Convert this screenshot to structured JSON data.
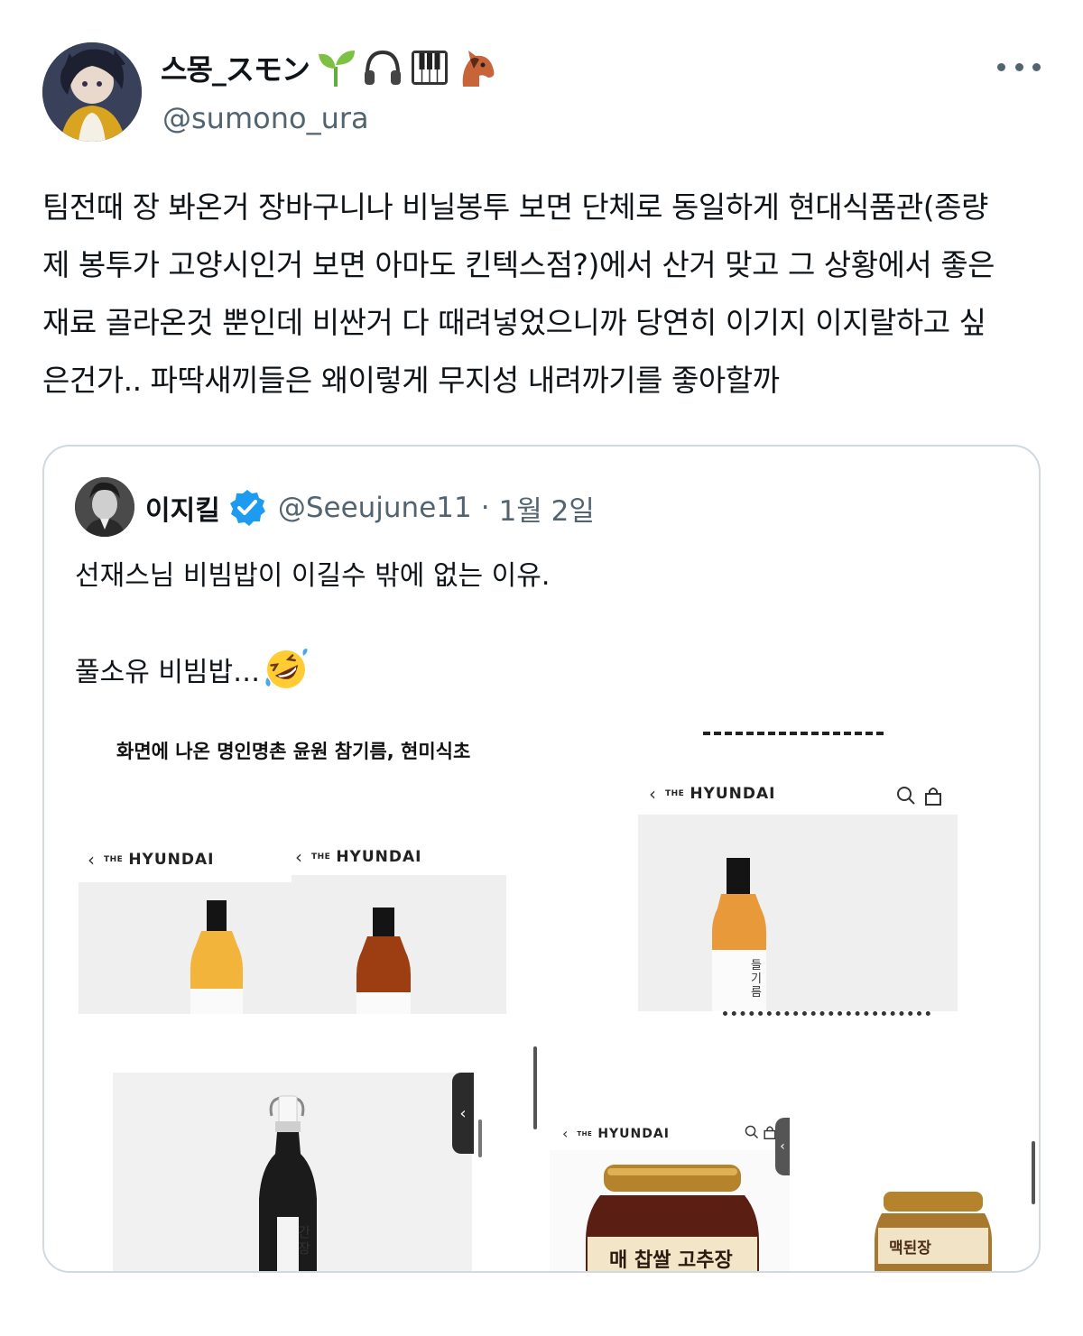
{
  "author": {
    "display_name": "스몽_スモン",
    "handle": "@sumono_ura",
    "emoji_icons": [
      "seedling-icon",
      "headphones-icon",
      "piano-icon",
      "horse-face-icon"
    ]
  },
  "tweet": {
    "lines": [
      "팀전때 장 봐온거 장바구니나 비닐봉투 보면 단체로 동일하게 현대식품관(종량",
      "제 봉투가 고양시인거 보면 아마도 킨텍스점?)에서 산거 맞고 그 상황에서 좋은",
      "재료 골라온것 뿐인데 비싼거 다 때려넣었으니까 당연히 이기지 이지랄하고 싶",
      "은건가.. 파딱새끼들은 왜이렇게 무지성 내려까기를 좋아할까"
    ]
  },
  "quote": {
    "display_name": "이지킬",
    "handle": "@Seeujune11",
    "separator": "·",
    "date": "1월 2일",
    "text_line1": "선재스님 비빔밥이 이길수 밖에 없는 이유.",
    "text_line2": "풀소유 비빔밥…",
    "media": {
      "caption": "화면에 나온 명인명촌 윤원 참기름, 현미식초",
      "store_the": "THE",
      "store_brand": "HYUNDAI",
      "back_glyph": "‹",
      "tab_glyph": "‹",
      "labels": {
        "perilla_oil": "들기름",
        "soy_sauce": "간장",
        "gochujang": "매 찹쌀 고추장",
        "doenjang": "맥된장"
      },
      "colors": {
        "oil_light": "#f2b43a",
        "oil_dark": "#9c3d12",
        "perilla": "#e89a3a",
        "soy": "#1b1b1b",
        "gochujang": "#5a1e12",
        "doenjang": "#a9782f",
        "lid_gold": "#b5832b"
      }
    }
  }
}
